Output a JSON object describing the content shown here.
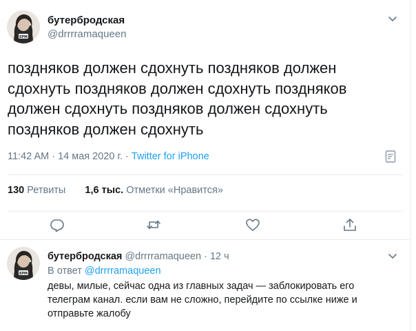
{
  "tweet": {
    "display_name": "бутербродская",
    "handle": "@drrrramaqueen",
    "text": "поздняков должен сдохнуть поздняков должен сдохнуть поздняков должен сдохнуть поздняков должен сдохнуть поздняков должен сдохнуть поздняков должен сдохнуть",
    "time": "11:42 AM",
    "date": "14 мая 2020 г.",
    "separator": "·",
    "source": "Twitter for iPhone",
    "retweets_count": "130",
    "retweets_label": "Ретвиты",
    "likes_count": "1,6 тыс.",
    "likes_label": "Отметки «Нравится»",
    "icons": {
      "caret": "chevron-down-icon",
      "analytics": "analytics-icon",
      "reply": "reply-icon",
      "retweet": "retweet-icon",
      "like": "heart-icon",
      "share": "share-icon"
    }
  },
  "reply": {
    "display_name": "бутербродская",
    "handle": "@drrrramaqueen",
    "separator": "·",
    "age": "12 ч",
    "in_reply_to_label": "В ответ",
    "in_reply_to_handle": "@drrrramaqueen",
    "text": "девы, милые, сейчас одна из главных задач — заблокировать его телеграм канал. если вам не сложно, перейдите по ссылке ниже и отправьте жалобу"
  },
  "colors": {
    "text": "#14171a",
    "secondary": "#657786",
    "link": "#1da1f2",
    "divider": "#e6ecf0"
  }
}
